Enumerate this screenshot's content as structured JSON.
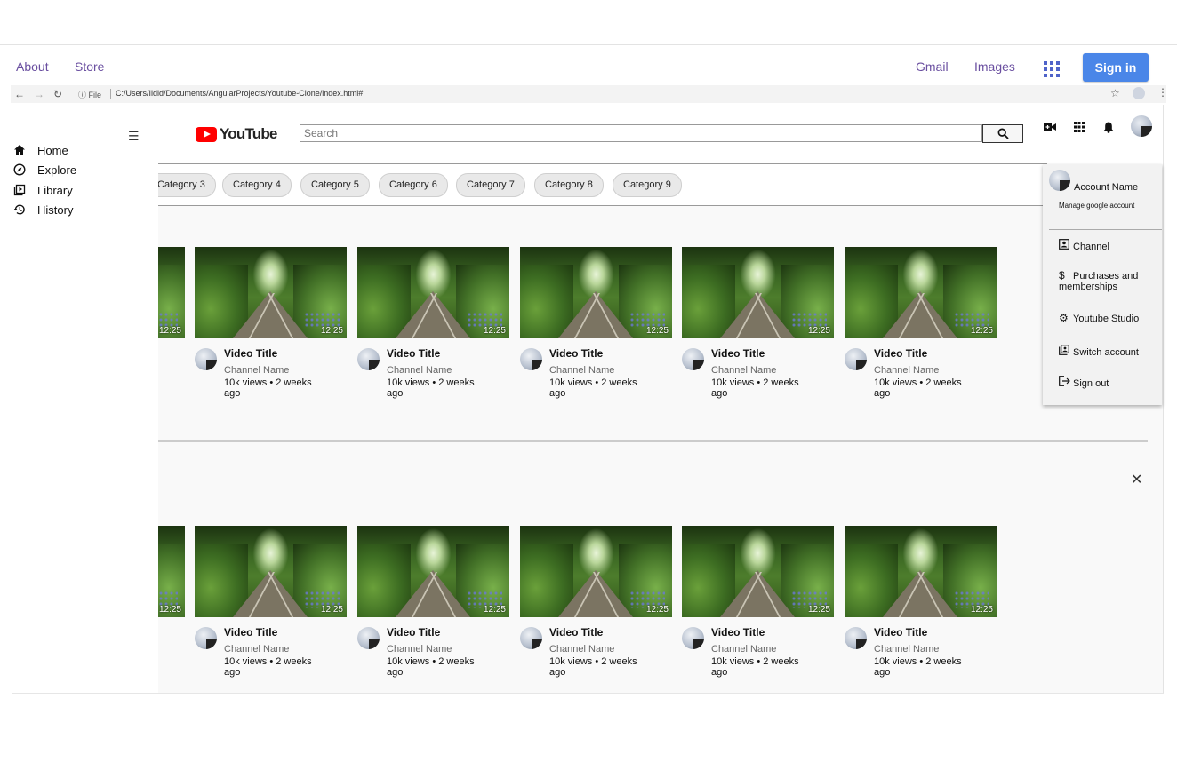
{
  "google_bar": {
    "left_links": [
      "About",
      "Store"
    ],
    "gmail": "Gmail",
    "images": "Images",
    "apps_icon": "apps-grid-icon",
    "sign_in": "Sign in"
  },
  "browser": {
    "file_label": "File",
    "url": "C:/Users/Ildid/Documents/AngularProjects/Youtube-Clone/index.html#"
  },
  "sidebar": {
    "items": [
      {
        "label": "Home",
        "icon": "home-icon"
      },
      {
        "label": "Explore",
        "icon": "compass-icon"
      },
      {
        "label": "Library",
        "icon": "library-icon"
      },
      {
        "label": "History",
        "icon": "history-icon"
      }
    ]
  },
  "header": {
    "logo_text": "YouTube",
    "search_placeholder": "Search"
  },
  "chips": [
    "Category 3",
    "Category 4",
    "Category 5",
    "Category 6",
    "Category 7",
    "Category 8",
    "Category 9"
  ],
  "videos": {
    "title": "Video Title",
    "channel": "Channel Name",
    "meta": "10k views • 2 weeks ago",
    "duration": "12:25"
  },
  "account_menu": {
    "name": "Account Name",
    "manage": "Manage google account",
    "items": [
      {
        "label": "Channel",
        "icon": "channel-icon"
      },
      {
        "label": "Purchases and memberships",
        "icon": "dollar-icon"
      },
      {
        "label": "Youtube Studio",
        "icon": "gear-icon"
      },
      {
        "label": "Switch account",
        "icon": "switch-account-icon"
      },
      {
        "label": "Sign out",
        "icon": "sign-out-icon"
      }
    ]
  },
  "colors": {
    "link": "#6a4fa0",
    "sign_in_bg": "#4a86e8",
    "youtube_red": "#ff0000"
  }
}
